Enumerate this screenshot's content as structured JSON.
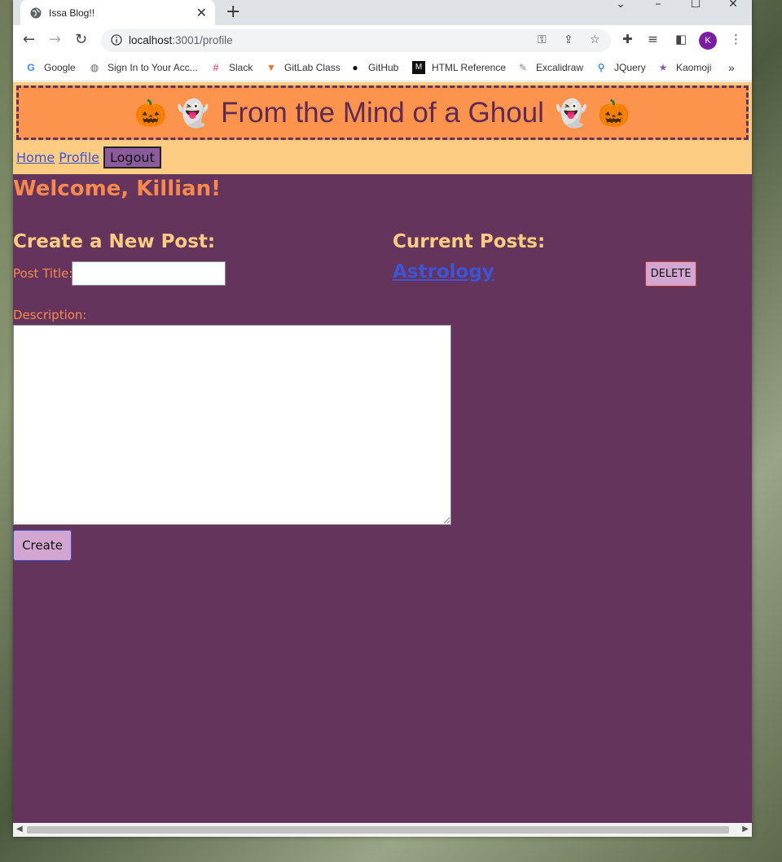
{
  "browser": {
    "tab_title": "Issa Blog!!",
    "tab_close": "✕",
    "new_tab": "+",
    "url_host": "localhost",
    "url_path": ":3001/profile",
    "avatar_initial": "K",
    "window_controls": {
      "dropdown": "⌄",
      "minimize": "–",
      "maximize": "☐",
      "close": "✕"
    },
    "nav": {
      "back": "←",
      "forward": "→",
      "reload": "↻"
    },
    "bookmarks": [
      {
        "label": "Google",
        "icon": "google-icon"
      },
      {
        "label": "Sign In to Your Acc...",
        "icon": "globe-icon"
      },
      {
        "label": "Slack",
        "icon": "slack-icon"
      },
      {
        "label": "GitLab Class",
        "icon": "gitlab-icon"
      },
      {
        "label": "GitHub",
        "icon": "github-icon"
      },
      {
        "label": "HTML Reference",
        "icon": "html-ref-icon"
      },
      {
        "label": "Excalidraw",
        "icon": "excalidraw-icon"
      },
      {
        "label": "JQuery",
        "icon": "search-icon"
      },
      {
        "label": "Kaomoji",
        "icon": "star-icon"
      }
    ],
    "bookmarks_overflow": "»"
  },
  "site": {
    "banner_title": "From the Mind of a Ghoul",
    "banner_emojis": {
      "pumpkin": "🎃",
      "ghost": "👻"
    },
    "nav": {
      "home": "Home",
      "profile": "Profile",
      "logout": "Logout"
    }
  },
  "profile": {
    "welcome": "Welcome, Killian!",
    "create_heading": "Create a New Post:",
    "post_title_label": "Post Title:",
    "post_title_value": "",
    "description_label": "Description:",
    "description_value": "",
    "create_button": "Create",
    "posts_heading": "Current Posts:",
    "posts": [
      {
        "title": "Astrology",
        "delete_label": "DELETE"
      }
    ]
  },
  "colors": {
    "page_bg": "#64345c",
    "header_bg": "#fdcc83",
    "banner_bg": "#fc944d",
    "banner_text": "#5f2b55",
    "heading_orange": "#f7894f",
    "heading_peach": "#fdcc83",
    "link_blue": "#3e54d6",
    "button_lilac": "#d3a6d1",
    "logout_purple": "#8b5c9c"
  }
}
